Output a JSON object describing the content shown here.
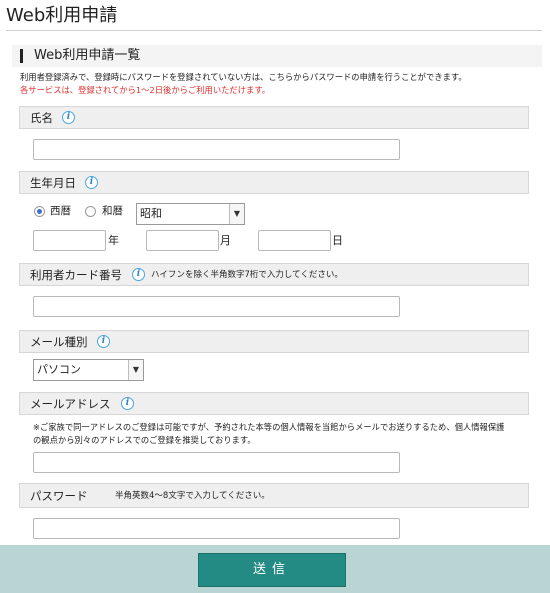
{
  "page": {
    "title": "Web利用申請"
  },
  "section": {
    "title": "Web利用申請一覧"
  },
  "intro": {
    "text": "利用者登録済みで、登録時にパスワードを登録されていない方は、こちらからパスワードの申請を行うことができます。",
    "note_red": "各サービスは、登録されてから1〜2日後からご利用いただけます。",
    "note_red_color": "#e03030"
  },
  "fields": {
    "name": {
      "label": "氏名",
      "icon": "info-icon",
      "value": ""
    },
    "birthdate": {
      "label": "生年月日",
      "icon": "info-icon",
      "era_options": [
        "西暦",
        "和暦"
      ],
      "selected_era": "西暦",
      "wareki_select": "昭和",
      "year_unit": "年",
      "month_unit": "月",
      "day_unit": "日"
    },
    "card_number": {
      "label": "利用者カード番号",
      "icon": "info-icon",
      "hint": "ハイフンを除く半角数字7桁で入力してください。"
    },
    "mail_type": {
      "label": "メール種別",
      "icon": "info-icon",
      "selected": "パソコン"
    },
    "mail_address": {
      "label": "メールアドレス",
      "icon": "info-icon",
      "note_line1": "※ご家族で同一アドレスのご登録は可能ですが、予約された本等の個人情報を当館からメールでお送りするため、個人情報保護",
      "note_line2": "の観点から別々のアドレスでのご登録を推奨しております。"
    },
    "password": {
      "label": "パスワード",
      "hint": "半角英数4〜8文字で入力してください。"
    }
  },
  "footer": {
    "submit_label": "送信"
  },
  "colors": {
    "accent": "#248a84",
    "footer_bg": "#b8d5d3",
    "info_icon": "#2f86c8"
  }
}
